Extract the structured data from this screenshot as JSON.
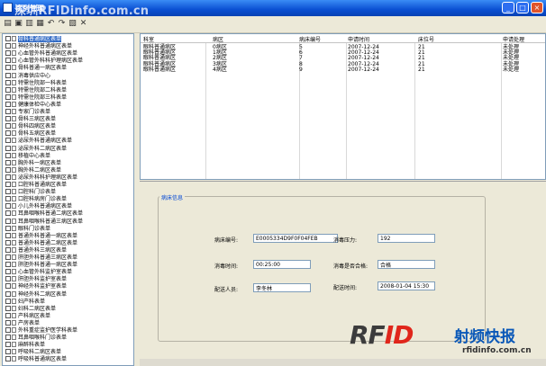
{
  "window": {
    "title": "病房管理",
    "watermark": "深圳RFIDinfo.com.cn"
  },
  "toolbar": {
    "icons": [
      "new-icon",
      "save-icon",
      "print-icon",
      "refresh-icon",
      "undo-icon",
      "redo-icon",
      "export-icon",
      "delete-icon"
    ]
  },
  "tree": {
    "items": [
      "骨科普通病区表单",
      "神经外科普通病区表单",
      "心血管外科普通病区表单",
      "心血管外科科护理病区表单",
      "骨科普通一病区表单",
      "消毒供应中心",
      "特需住院部一科表单",
      "特需住院部二科表单",
      "特需住院部三科表单",
      "健康体检中心表单",
      "专家门诊表单",
      "骨科三病区表单",
      "骨科四病区表单",
      "骨科五病区表单",
      "泌尿外科普通病区表单",
      "泌尿外科二病区表单",
      "移植中心表单",
      "胸外科一病区表单",
      "胸外科二病区表单",
      "泌尿外科科护理病区表单",
      "口腔科普通病区表单",
      "口腔科门诊表单",
      "口腔科病房门诊表单",
      "小儿外科普通病区表单",
      "耳鼻咽喉科普通二病区表单",
      "耳鼻咽喉科普通三病区表单",
      "眼科门诊表单",
      "普通外科普通一病区表单",
      "普通外科普通二病区表单",
      "普通外科三病区表单",
      "肝胆外科普通三病区表单",
      "肝胆外科普通一病区表单",
      "心血管外科监护室表单",
      "肝胆外科监护室表单",
      "神经外科监护室表单",
      "神经外科二病区表单",
      "妇产科表单",
      "妇科二病区表单",
      "产科病区表单",
      "产房表单",
      "外科重症监护医学科表单",
      "耳鼻咽喉科门诊表单",
      "麻醉科表单",
      "呼吸科二病区表单",
      "呼吸科普通病区表单"
    ]
  },
  "grid": {
    "columns": [
      "科室",
      "病区",
      "病床编号",
      "申请时间",
      "床位号",
      "申请处理"
    ],
    "rows": [
      [
        "眼科普通病区",
        "0病区",
        "5",
        "2007-12-24",
        "21",
        "未处理"
      ],
      [
        "眼科普通病区",
        "1病区",
        "6",
        "2007-12-24",
        "21",
        "未处理"
      ],
      [
        "眼科普通病区",
        "2病区",
        "7",
        "2007-12-24",
        "21",
        "未处理"
      ],
      [
        "眼科普通病区",
        "3病区",
        "8",
        "2007-12-24",
        "21",
        "未处理"
      ],
      [
        "眼科普通病区",
        "4病区",
        "9",
        "2007-12-24",
        "21",
        "未处理"
      ]
    ]
  },
  "detail": {
    "group_title": "病床信息",
    "fields": {
      "bed_no": {
        "label": "病床编号:",
        "value": "E0005334D9F0F04FEB"
      },
      "disinfect_time": {
        "label": "消毒时间:",
        "value": "00:25:00"
      },
      "dispatcher": {
        "label": "配送人员:",
        "value": "李冬林"
      },
      "disinfect_pressure": {
        "label": "消毒压力:",
        "value": "192"
      },
      "disinfect_qualified": {
        "label": "消毒是否合格:",
        "value": "合格"
      },
      "delivery_time": {
        "label": "配送时间:",
        "value": "2008-01-04 15:30"
      }
    }
  },
  "logo": {
    "brand_a": "RF",
    "brand_b": "ID",
    "cn": "射频快报",
    "url": "rfidinfo.com.cn"
  },
  "colors": {
    "titlebar": "#0a4fd2",
    "accent_blue": "#0046d5",
    "logo_red": "#e0261b"
  }
}
